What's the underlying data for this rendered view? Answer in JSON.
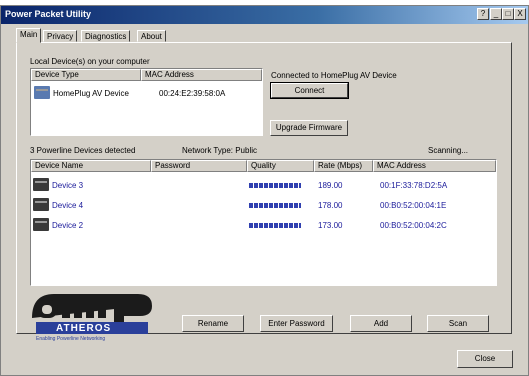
{
  "window": {
    "title": "Power Packet Utility",
    "buttons": [
      "?",
      "_",
      "□",
      "X"
    ]
  },
  "tabs": [
    "Main",
    "Privacy",
    "Diagnostics",
    "About"
  ],
  "local": {
    "label": "Local Device(s) on your computer",
    "headers": [
      "Device Type",
      "MAC Address"
    ],
    "rows": [
      {
        "device": "HomePlug AV Device",
        "mac": "00:24:E2:39:58:0A",
        "icon": "homeplug-device-icon"
      }
    ]
  },
  "connection": {
    "status": "Connected to HomePlug AV Device",
    "connect_label": "Connect",
    "upgrade_label": "Upgrade Firmware"
  },
  "powerline": {
    "detected": "3 Powerline Devices detected",
    "network_type": "Network Type: Public",
    "scanning": "Scanning...",
    "headers": [
      "Device Name",
      "Password",
      "Quality",
      "Rate (Mbps)",
      "MAC Address"
    ],
    "rows": [
      {
        "name": "Device 3",
        "password": "",
        "rate": "189.00",
        "mac": "00:1F:33:78:D2:5A",
        "quality": 1.0
      },
      {
        "name": "Device 4",
        "password": "",
        "rate": "178.00",
        "mac": "00:B0:52:00:04:1E",
        "quality": 1.0
      },
      {
        "name": "Device 2",
        "password": "",
        "rate": "173.00",
        "mac": "00:B0:52:00:04:2C",
        "quality": 1.0
      }
    ]
  },
  "logo": {
    "brand": "ATHEROS",
    "mark": "amp",
    "tagline": "Enabling Powerline Networking"
  },
  "actions": {
    "rename": "Rename",
    "enter_password": "Enter Password",
    "add": "Add",
    "scan": "Scan",
    "close": "Close"
  },
  "colors": {
    "titlebar": "#0a246a",
    "link_text": "#1a1a9a",
    "quality_bar": "#3040b0"
  }
}
